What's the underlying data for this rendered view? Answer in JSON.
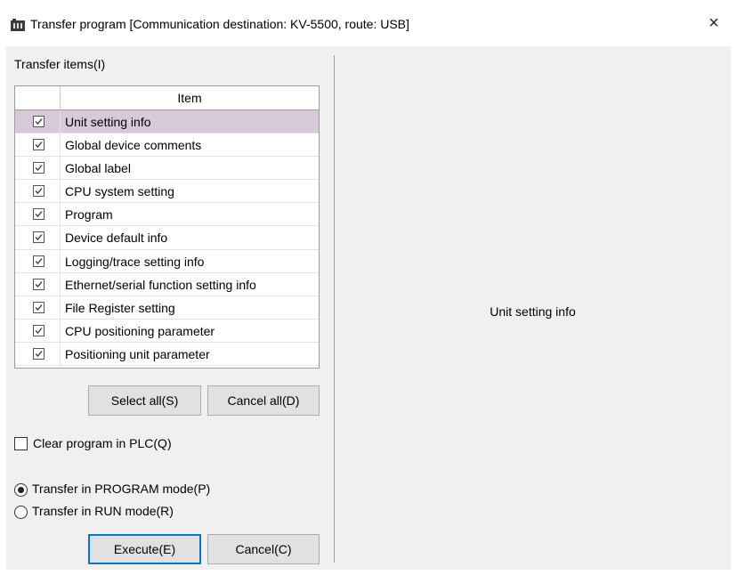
{
  "window": {
    "title": "Transfer program [Communication destination: KV-5500, route: USB]",
    "close_glyph": "×",
    "icon": "app-icon"
  },
  "transfer_items": {
    "label": "Transfer items(I)",
    "header_item": "Item",
    "items": [
      {
        "label": "Unit setting info",
        "checked": true,
        "selected": true
      },
      {
        "label": "Global device comments",
        "checked": true
      },
      {
        "label": "Global label",
        "checked": true
      },
      {
        "label": "CPU system setting",
        "checked": true
      },
      {
        "label": "Program",
        "checked": true
      },
      {
        "label": "Device default info",
        "checked": true
      },
      {
        "label": "Logging/trace setting info",
        "checked": true
      },
      {
        "label": "Ethernet/serial function setting info",
        "checked": true
      },
      {
        "label": "File Register setting",
        "checked": true
      },
      {
        "label": "CPU positioning parameter",
        "checked": true
      },
      {
        "label": "Positioning unit parameter",
        "checked": true
      }
    ]
  },
  "buttons": {
    "select_all": "Select all(S)",
    "cancel_all": "Cancel all(D)",
    "execute": "Execute(E)",
    "cancel": "Cancel(C)"
  },
  "options": {
    "clear_program": {
      "label": "Clear program in PLC(Q)",
      "checked": false
    },
    "mode": {
      "options": [
        {
          "label": "Transfer in PROGRAM mode(P)",
          "selected": true
        },
        {
          "label": "Transfer in RUN mode(R)",
          "selected": false
        }
      ]
    }
  },
  "detail": {
    "text": "Unit setting info"
  },
  "colors": {
    "selection": "#d8c9d8",
    "default_button_border": "#0078d7",
    "dialog_bg": "#f0f0f0"
  }
}
